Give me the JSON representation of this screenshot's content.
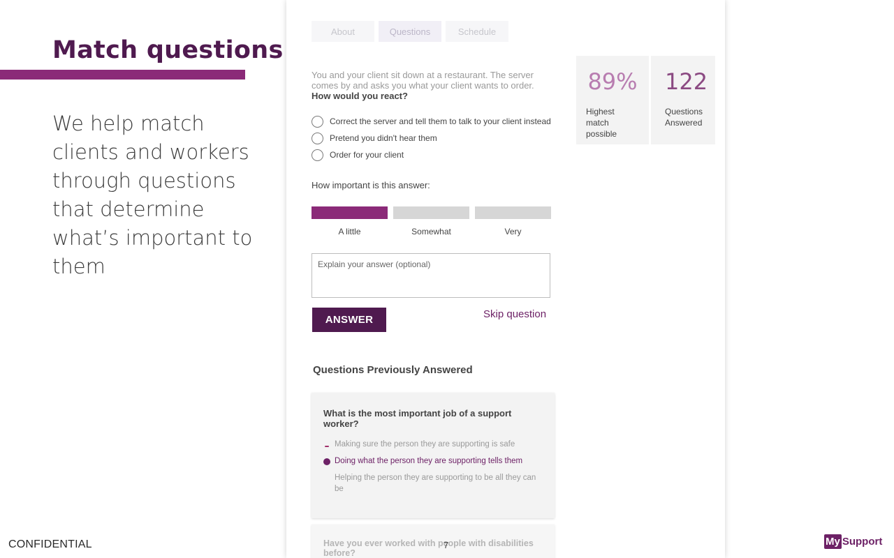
{
  "slide": {
    "title": "Match questions",
    "body": "We help match clients and workers through questions that determine what’s important to them",
    "footer_left": "CONFIDENTIAL",
    "page_number": "7",
    "logo_my": "My",
    "logo_support": "Support"
  },
  "app": {
    "tabs": [
      {
        "label": "About",
        "active": false
      },
      {
        "label": "Questions",
        "active": true
      },
      {
        "label": "Schedule",
        "active": false
      }
    ],
    "question_intro": "You and your client sit down at a restaurant. The server comes by and asks you what your client wants to order.",
    "question_ask": "How would you react?",
    "options": [
      "Correct the server and tell them to talk to your client instead",
      "Pretend you didn't hear them",
      "Order for your client"
    ],
    "importance": {
      "label": "How important is this answer:",
      "levels": [
        "A little",
        "Somewhat",
        "Very"
      ],
      "selected": "A little"
    },
    "explain_placeholder": "Explain your answer (optional)",
    "answer_button": "ANSWER",
    "skip_link": "Skip question",
    "stats": {
      "match_value": "89%",
      "match_label": "Highest match possible",
      "answered_value": "122",
      "answered_label": "Questions Answered"
    },
    "previous": {
      "heading": "Questions Previously Answered",
      "card1": {
        "question": "What is the most important job of a support worker?",
        "options": [
          "Making sure the person they are supporting is safe",
          "Doing what the person they are supporting tells them",
          "Helping the person they are supporting to be all they can be"
        ],
        "selected_index": 1
      },
      "card2": {
        "question": "Have you ever worked with people with disabilities before?"
      }
    },
    "colors": {
      "brand_dark": "#4f1a4f",
      "brand": "#8b2a78",
      "accent_light": "#b87db0"
    }
  }
}
